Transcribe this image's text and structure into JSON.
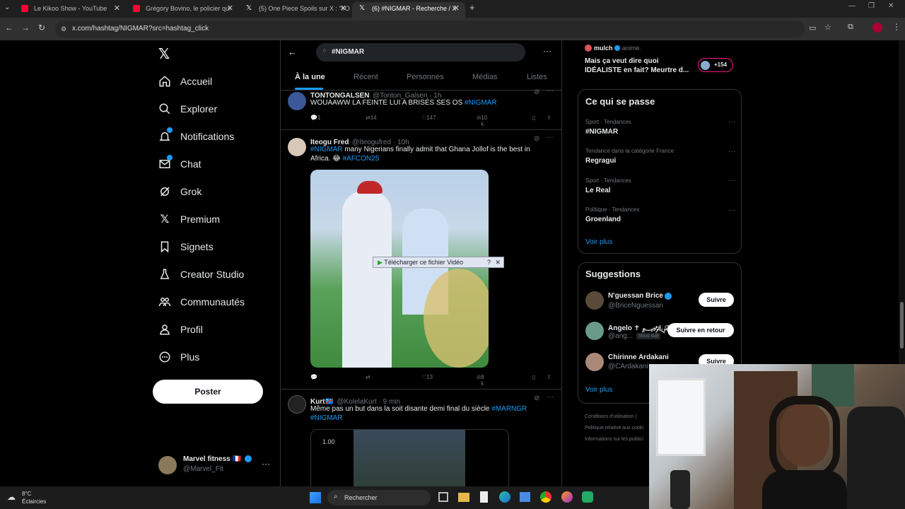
{
  "browser": {
    "tabs": [
      {
        "title": "Le Kikoo Show - YouTube",
        "color": "#ff0033"
      },
      {
        "title": "Grégory Bovino, le policier qui",
        "color": "#ff0033"
      },
      {
        "title": "(5) One Piece Spoils sur X : \"#O",
        "color": "#ffffff"
      },
      {
        "title": "(6) #NIGMAR - Recherche / X",
        "color": "#ffffff"
      }
    ],
    "url": "x.com/hashtag/NIGMAR?src=hashtag_click"
  },
  "nav": {
    "items": [
      {
        "label": "Accueil",
        "icon": "home-icon"
      },
      {
        "label": "Explorer",
        "icon": "search-icon"
      },
      {
        "label": "Notifications",
        "icon": "bell-icon"
      },
      {
        "label": "Chat",
        "icon": "mail-icon"
      },
      {
        "label": "Grok",
        "icon": "grok-icon"
      },
      {
        "label": "Premium",
        "icon": "x-logo-icon"
      },
      {
        "label": "Signets",
        "icon": "bookmark-icon"
      },
      {
        "label": "Creator Studio",
        "icon": "flask-icon"
      },
      {
        "label": "Communautés",
        "icon": "people-icon"
      },
      {
        "label": "Profil",
        "icon": "person-icon"
      },
      {
        "label": "Plus",
        "icon": "more-circle-icon"
      }
    ],
    "post_label": "Poster",
    "account": {
      "name": "Marvel fitness 🇫🇷",
      "handle": "@Marvel_Fit"
    }
  },
  "search": {
    "value": "#NIGMAR"
  },
  "tabs": [
    "À la une",
    "Récent",
    "Personnes",
    "Médias",
    "Listes"
  ],
  "tweets": [
    {
      "name": "TONTONGALSEN",
      "handle": "@Tonton_Galsen · 1h",
      "text": "WOUAAWW LA FEINTE LUI A BRISÉS SES OS ",
      "hashtag": "#NIGMAR",
      "replies": "1",
      "retweets": "14",
      "likes": "147",
      "views": "10 k"
    },
    {
      "name": "Iteogu Fred",
      "handle": "@Iteogufred · 10h",
      "hashtag1": "#NIGMAR",
      "text": " many Nigerians finally admit that Ghana Jollof is the best in Africa. 😂 ",
      "hashtag2": "#AFCON25",
      "overlay": "Télécharger ce fichier Vidéo",
      "replies": "",
      "retweets": "",
      "likes": "13",
      "views": "8 k"
    },
    {
      "name": "Kurt🇨🇩",
      "handle": "@KolelaKurt · 9 min",
      "text": "Même pas un but dans la soit disante demi final du siècle ",
      "hashtag1": "#MARNGR",
      "hashtag2": "#NIGMAR",
      "video_time": "1.00"
    }
  ],
  "right": {
    "top_user": {
      "name": "mulch",
      "meta": "anime.",
      "text1": "Mais ça veut dire quoi",
      "text2": "IDÉALISTE en fait? Meurtre d...",
      "count": "+154"
    },
    "trends_title": "Ce qui se passe",
    "trends": [
      {
        "category": "Sport · Tendances",
        "name": "#NIGMAR"
      },
      {
        "category": "Tendance dans la catégorie France",
        "name": "Regragui"
      },
      {
        "category": "Sport · Tendances",
        "name": "Le Real"
      },
      {
        "category": "Politique · Tendances",
        "name": "Groenland"
      }
    ],
    "trends_more": "Voir plus",
    "suggestions_title": "Suggestions",
    "suggestions": [
      {
        "name": "N'guessan Brice",
        "handle": "@BriceNguessan",
        "button": "Suivre"
      },
      {
        "name": "Angelo ✝ ﷽",
        "handle": "@ang...",
        "tag": "Vous suit",
        "button": "Suivre en retour"
      },
      {
        "name": "Chirinne Ardakani",
        "handle": "@CArdakani",
        "button": "Suivre"
      }
    ],
    "suggestions_more": "Voir plus",
    "footer": [
      "Conditions d'utilisation  |",
      "Politique relative aux cooki",
      "Informations sur les publici"
    ]
  },
  "taskbar": {
    "temp": "8°C",
    "weather": "Éclaircies",
    "search": "Rechercher"
  }
}
